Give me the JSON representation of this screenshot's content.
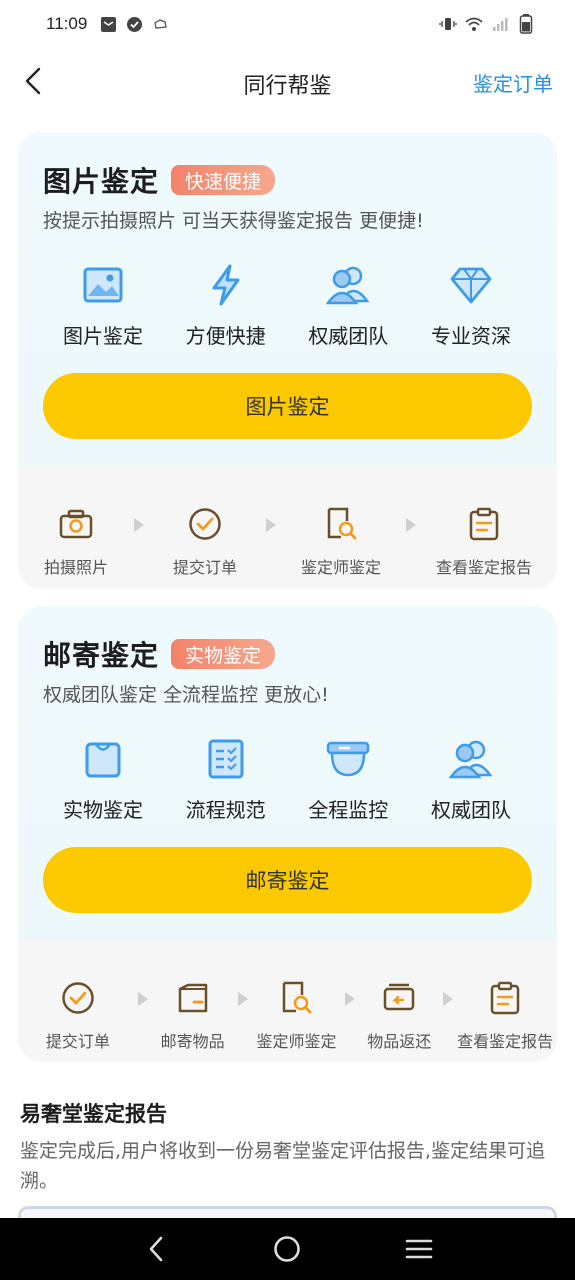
{
  "status": {
    "time": "11:09"
  },
  "nav": {
    "title": "同行帮鉴",
    "action": "鉴定订单"
  },
  "cards": [
    {
      "title": "图片鉴定",
      "badge": "快速便捷",
      "subtitle": "按提示拍摄照片 可当天获得鉴定报告 更便捷!",
      "features": [
        {
          "label": "图片鉴定",
          "icon": "image-icon"
        },
        {
          "label": "方便快捷",
          "icon": "lightning-icon"
        },
        {
          "label": "权威团队",
          "icon": "team-icon"
        },
        {
          "label": "专业资深",
          "icon": "diamond-icon"
        }
      ],
      "button": "图片鉴定",
      "steps": [
        {
          "label": "拍摄照片",
          "icon": "camera-icon"
        },
        {
          "label": "提交订单",
          "icon": "check-circle-icon"
        },
        {
          "label": "鉴定师鉴定",
          "icon": "magnify-doc-icon"
        },
        {
          "label": "查看鉴定报告",
          "icon": "clipboard-icon"
        }
      ]
    },
    {
      "title": "邮寄鉴定",
      "badge": "实物鉴定",
      "subtitle": "权威团队鉴定 全流程监控 更放心!",
      "features": [
        {
          "label": "实物鉴定",
          "icon": "bag-icon"
        },
        {
          "label": "流程规范",
          "icon": "checklist-icon"
        },
        {
          "label": "全程监控",
          "icon": "camera-dome-icon"
        },
        {
          "label": "权威团队",
          "icon": "team-icon"
        }
      ],
      "button": "邮寄鉴定",
      "steps": [
        {
          "label": "提交订单",
          "icon": "check-circle-icon"
        },
        {
          "label": "邮寄物品",
          "icon": "parcel-icon"
        },
        {
          "label": "鉴定师鉴定",
          "icon": "magnify-doc-icon"
        },
        {
          "label": "物品返还",
          "icon": "return-box-icon"
        },
        {
          "label": "查看鉴定报告",
          "icon": "clipboard-icon"
        }
      ]
    }
  ],
  "report": {
    "title": "易奢堂鉴定报告",
    "description": "鉴定完成后,用户将收到一份易奢堂鉴定评估报告,鉴定结果可追溯。"
  },
  "colors": {
    "accent_blue": "#2a8fe0",
    "button_yellow": "#fcc800",
    "badge_orange": "#f3826a",
    "step_icon": "#6b4f2a"
  }
}
